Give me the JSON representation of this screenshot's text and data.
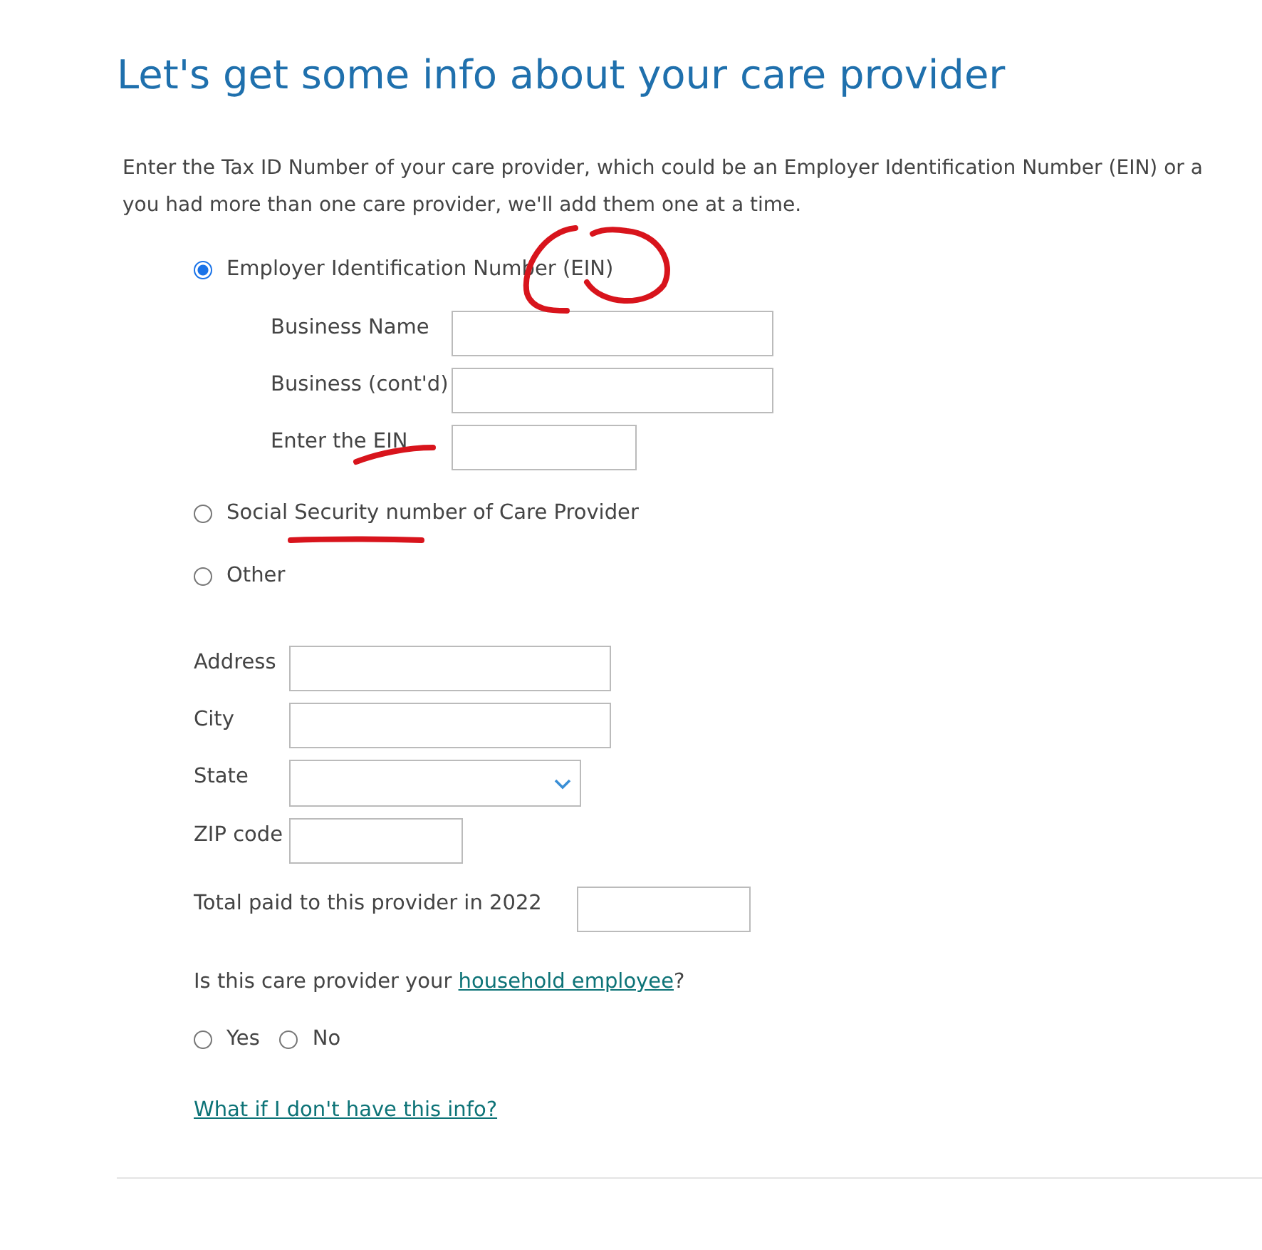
{
  "title": "Let's get some info about your care provider",
  "intro": "Enter the Tax ID Number of your care provider, which could be an Employer Identification Number (EIN) or a\nyou had more than one care provider, we'll add them one at a time.",
  "id_types": [
    {
      "label": "Employer Identification Number (EIN)",
      "selected": true,
      "fields": [
        {
          "label": "Business Name",
          "kind": "text"
        },
        {
          "label": "Business (cont'd)",
          "kind": "text"
        },
        {
          "label": "Enter the EIN",
          "kind": "short"
        }
      ]
    },
    {
      "label": "Social Security number of Care Provider",
      "selected": false
    },
    {
      "label": "Other",
      "selected": false
    }
  ],
  "address_fields": [
    {
      "label": "Address",
      "kind": "text"
    },
    {
      "label": "City",
      "kind": "text"
    },
    {
      "label": "State",
      "kind": "select"
    },
    {
      "label": "ZIP code",
      "kind": "short"
    }
  ],
  "total_paid": {
    "label": "Total paid to this provider in 2022"
  },
  "question": {
    "text": "Is this care provider your",
    "link": "household employee",
    "end": "?"
  },
  "answers": [
    {
      "label": "Yes",
      "selected": false
    },
    {
      "label": "No",
      "selected": false
    }
  ],
  "help_link": "What if I don't have this info?",
  "annotations": [
    {
      "kind": "circle"
    },
    {
      "kind": "stroke"
    },
    {
      "kind": "underline"
    }
  ]
}
